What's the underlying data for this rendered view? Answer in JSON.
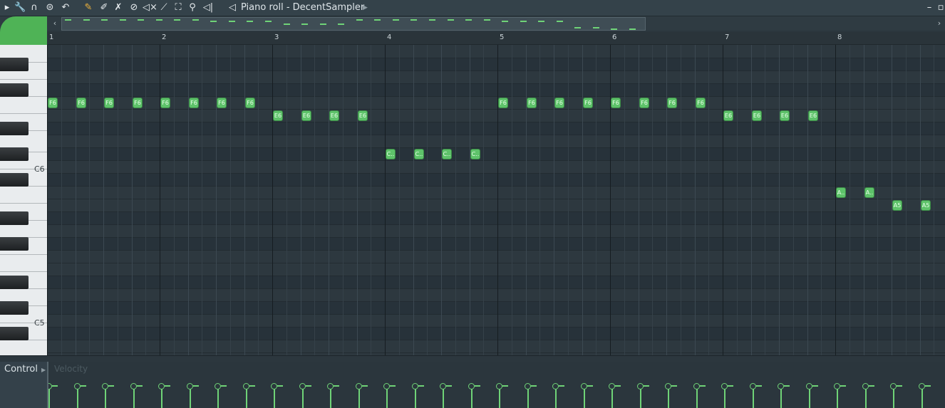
{
  "window": {
    "title": "Piano roll - DecentSampler"
  },
  "toolbar": {
    "icons": [
      "menu-arrow-icon",
      "wrench-icon",
      "magnet-icon",
      "menu-circle-icon",
      "undo-icon",
      "pencil-icon",
      "paint-brush-icon",
      "paint-brush-x-icon",
      "delete-circle-icon",
      "mute-icon",
      "slice-icon",
      "select-icon",
      "zoom-icon",
      "playback-icon"
    ]
  },
  "ruler": {
    "bars": [
      "1",
      "2",
      "3",
      "4",
      "5",
      "6",
      "7",
      "8"
    ]
  },
  "keys": {
    "labels": [
      "C6",
      "C5"
    ]
  },
  "notes": [
    {
      "label": "F6",
      "time": 0.0,
      "row": 4
    },
    {
      "label": "F6",
      "time": 0.25,
      "row": 4
    },
    {
      "label": "F6",
      "time": 0.5,
      "row": 4
    },
    {
      "label": "F6",
      "time": 0.75,
      "row": 4
    },
    {
      "label": "F6",
      "time": 1.0,
      "row": 4
    },
    {
      "label": "F6",
      "time": 1.25,
      "row": 4
    },
    {
      "label": "F6",
      "time": 1.5,
      "row": 4
    },
    {
      "label": "F6",
      "time": 1.75,
      "row": 4
    },
    {
      "label": "E6",
      "time": 2.0,
      "row": 5
    },
    {
      "label": "E6",
      "time": 2.25,
      "row": 5
    },
    {
      "label": "E6",
      "time": 2.5,
      "row": 5
    },
    {
      "label": "E6",
      "time": 2.75,
      "row": 5
    },
    {
      "label": "C..",
      "time": 3.0,
      "row": 8
    },
    {
      "label": "C..",
      "time": 3.25,
      "row": 8
    },
    {
      "label": "C..",
      "time": 3.5,
      "row": 8
    },
    {
      "label": "C..",
      "time": 3.75,
      "row": 8
    },
    {
      "label": "F6",
      "time": 4.0,
      "row": 4
    },
    {
      "label": "F6",
      "time": 4.25,
      "row": 4
    },
    {
      "label": "F6",
      "time": 4.5,
      "row": 4
    },
    {
      "label": "F6",
      "time": 4.75,
      "row": 4
    },
    {
      "label": "F6",
      "time": 5.0,
      "row": 4
    },
    {
      "label": "F6",
      "time": 5.25,
      "row": 4
    },
    {
      "label": "F6",
      "time": 5.5,
      "row": 4
    },
    {
      "label": "F6",
      "time": 5.75,
      "row": 4
    },
    {
      "label": "E6",
      "time": 6.0,
      "row": 5
    },
    {
      "label": "E6",
      "time": 6.25,
      "row": 5
    },
    {
      "label": "E6",
      "time": 6.5,
      "row": 5
    },
    {
      "label": "E6",
      "time": 6.75,
      "row": 5
    },
    {
      "label": "A..",
      "time": 7.0,
      "row": 11
    },
    {
      "label": "A..",
      "time": 7.25,
      "row": 11
    },
    {
      "label": "A5",
      "time": 7.5,
      "row": 12
    },
    {
      "label": "A5",
      "time": 7.75,
      "row": 12
    }
  ],
  "control": {
    "label": "Control",
    "target": "Velocity"
  },
  "colors": {
    "note": "#5ec26a",
    "accent": "#4fb356",
    "background": "#2d383f"
  }
}
